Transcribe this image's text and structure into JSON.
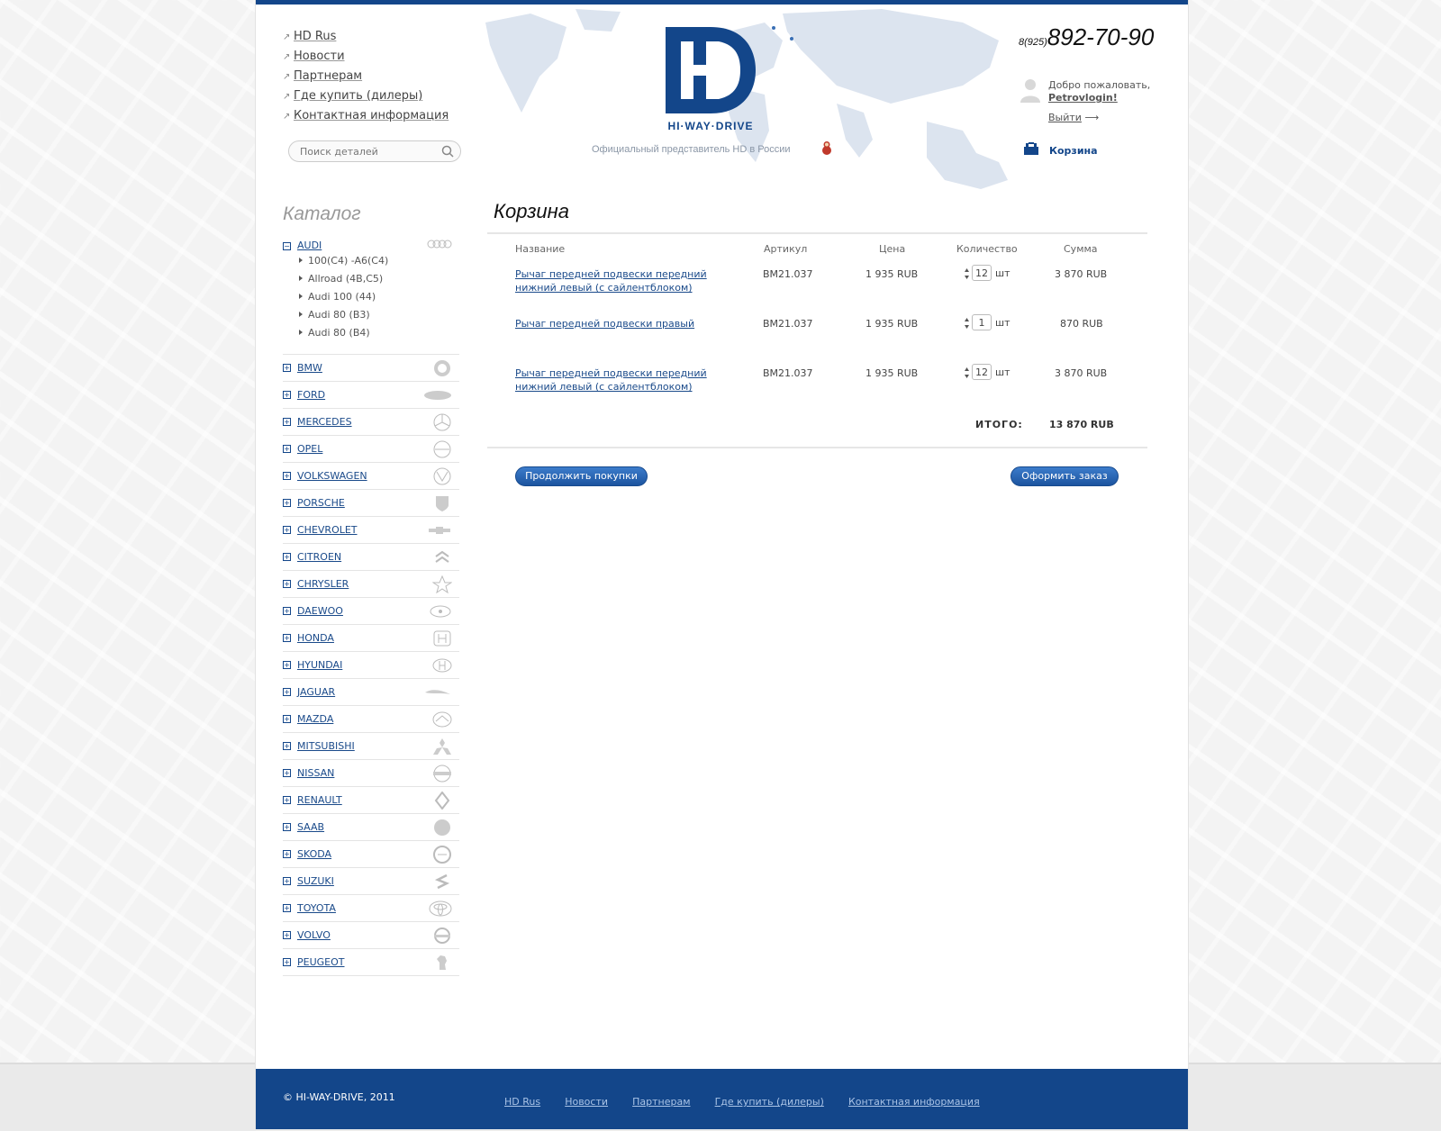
{
  "header": {
    "nav": [
      {
        "label": "HD Rus"
      },
      {
        "label": "Новости"
      },
      {
        "label": "Партнерам"
      },
      {
        "label": "Где купить (дилеры)"
      },
      {
        "label": "Контактная информация"
      }
    ],
    "search_placeholder": "Поиск деталей",
    "logo_text": "HI·WAY·DRIVE",
    "official": "Официальный представитель HD в России",
    "phone_prefix": "8(925)",
    "phone_number": "892-70-90",
    "welcome": "Добро пожаловать,",
    "username": "Petrovlogin!",
    "logout": "Выйти",
    "cart": "Корзина"
  },
  "catalog": {
    "title": "Каталог",
    "open_brand": {
      "name": "AUDI",
      "models": [
        "100(C4) -A6(C4)",
        "Allroad (4B,C5)",
        "Audi 100 (44)",
        "Audi 80 (B3)",
        "Audi 80 (B4)"
      ]
    },
    "brands": [
      "BMW",
      "FORD",
      "MERCEDES",
      "OPEL",
      "VOLKSWAGEN",
      "PORSCHE",
      "CHEVROLET",
      "CITROEN",
      "CHRYSLER",
      "DAEWOO",
      "HONDA",
      "HYUNDAI",
      "JAGUAR",
      "MAZDA",
      "MITSUBISHI",
      "NISSAN",
      "RENAULT",
      "SAAB",
      "SKODA",
      "SUZUKI",
      "TOYOTA",
      "VOLVO",
      "PEUGEOT"
    ]
  },
  "cart": {
    "title": "Корзина",
    "columns": {
      "name": "Название",
      "article": "Артикул",
      "price": "Цена",
      "qty": "Количество",
      "sum": "Сумма"
    },
    "unit": "шт",
    "rows": [
      {
        "name_line1": "Рычаг передней подвески передний",
        "name_line2": "нижний левый (с сайлентблоком)",
        "article": "BM21.037",
        "price": "1 935 RUB",
        "qty": "12",
        "sum": "3 870 RUB"
      },
      {
        "name_line1": "Рычаг передней подвески правый",
        "name_line2": "",
        "article": "BM21.037",
        "price": "1 935 RUB",
        "qty": "1",
        "sum": "870 RUB"
      },
      {
        "name_line1": "Рычаг передней подвески передний",
        "name_line2": "нижний левый (с сайлентблоком)",
        "article": "BM21.037",
        "price": "1 935 RUB",
        "qty": "12",
        "sum": "3 870 RUB"
      }
    ],
    "total_label": "ИТОГО:",
    "total_value": "13 870 RUB",
    "continue_button": "Продолжить покупки",
    "checkout_button": "Оформить заказ"
  },
  "footer": {
    "copyright": "© HI-WAY-DRIVE, 2011",
    "nav": [
      "HD Rus",
      "Новости",
      "Партнерам",
      "Где купить (дилеры)",
      "Контактная информация"
    ]
  }
}
